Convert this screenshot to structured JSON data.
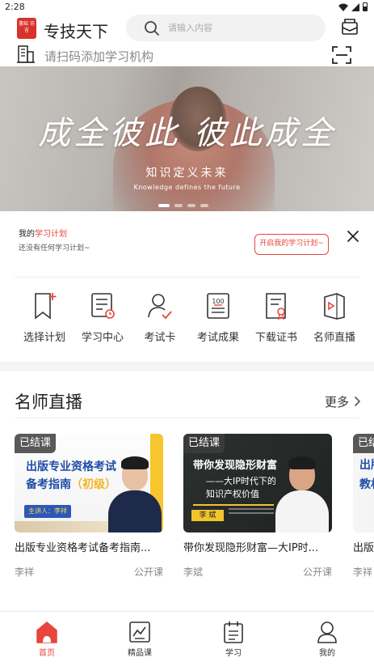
{
  "status_bar": {
    "time": "2:28"
  },
  "header": {
    "logo_text": "書紹 坊吉",
    "app_title": "专技天下",
    "search_placeholder": "请输入内容"
  },
  "scan_row": {
    "text": "请扫码添加学习机构"
  },
  "banner": {
    "slogan": "成全彼此 彼此成全",
    "subtitle_cn": "知识定义未来",
    "subtitle_en": "Knowledge defines the future",
    "slide_count": 4,
    "active_slide": 1
  },
  "study_plan": {
    "prefix": "我的",
    "accent": "学习计划",
    "empty_text": "还没有任何学习计划~",
    "button_label": "开启我的学习计划~"
  },
  "quick_menu": [
    {
      "label": "选择计划",
      "icon": "bookmark-plus-icon"
    },
    {
      "label": "学习中心",
      "icon": "schedule-list-icon"
    },
    {
      "label": "考试卡",
      "icon": "user-check-icon"
    },
    {
      "label": "考试成果",
      "icon": "score-100-icon"
    },
    {
      "label": "下载证书",
      "icon": "certificate-icon"
    },
    {
      "label": "名师直播",
      "icon": "video-play-icon"
    }
  ],
  "live_section": {
    "title": "名师直播",
    "more_label": "更多",
    "cards": [
      {
        "badge": "已结课",
        "title": "出版专业资格考试备考指南...",
        "teacher": "李祥",
        "tag": "公开课",
        "thumb_line1": "出版专业资格考试",
        "thumb_line2": "备考指南",
        "thumb_level": "（初级）",
        "thumb_speaker": "主讲人：李祥"
      },
      {
        "badge": "已结课",
        "title": "带你发现隐形财富—大IP时...",
        "teacher": "李斌",
        "tag": "公开课",
        "thumb_line1": "带你发现隐形财富",
        "thumb_line2": "——大IP时代下的",
        "thumb_line3": "知识产权价值",
        "thumb_speaker": "李 斌"
      },
      {
        "badge": "已结",
        "title": "出版",
        "teacher": "李祥",
        "thumb_line1": "出版",
        "thumb_line2": "教材"
      }
    ]
  },
  "tab_bar": [
    {
      "label": "首页",
      "icon": "home-icon",
      "active": true
    },
    {
      "label": "精品课",
      "icon": "chart-board-icon",
      "active": false
    },
    {
      "label": "学习",
      "icon": "calendar-list-icon",
      "active": false
    },
    {
      "label": "我的",
      "icon": "profile-icon",
      "active": false
    }
  ],
  "colors": {
    "accent": "#e8453c",
    "brand_red": "#d8322a",
    "live_title_blue": "#1f4ea8",
    "highlight_yellow": "#f2c42e"
  }
}
